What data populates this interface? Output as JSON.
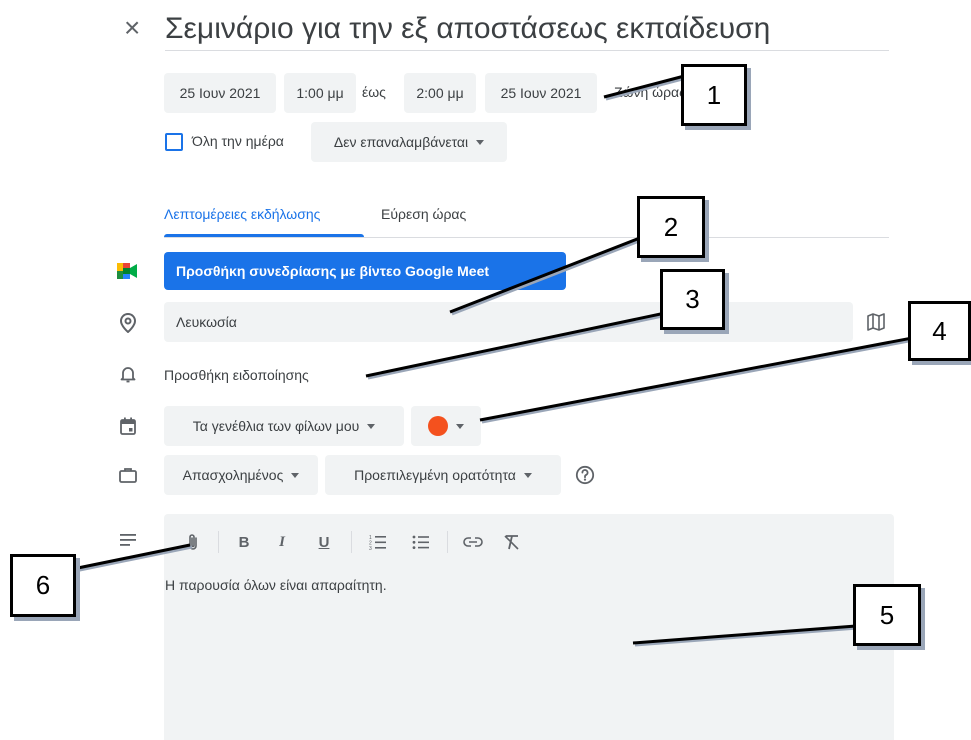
{
  "header": {
    "close_glyph": "×",
    "title": "Σεμινάριο για την εξ αποστάσεως εκπαίδευση"
  },
  "datetime": {
    "start_date": "25 Ιουν 2021",
    "start_time": "1:00 μμ",
    "until": "έως",
    "end_time": "2:00 μμ",
    "end_date": "25 Ιουν 2021",
    "timezone": "Ζώνη ώρας"
  },
  "allday": {
    "label": "Όλη την ημέρα",
    "checked": false,
    "repeat": "Δεν επαναλαμβάνεται"
  },
  "tabs": [
    {
      "label": "Λεπτομέρειες εκδήλωσης",
      "active": true
    },
    {
      "label": "Εύρεση ώρας",
      "active": false
    }
  ],
  "meet_button": "Προσθήκη συνεδρίασης με βίντεο Google Meet",
  "location": {
    "value": "Λευκωσία"
  },
  "notification": {
    "label": "Προσθήκη ειδοποίησης"
  },
  "calendar": {
    "name": "Τα γενέθλια των φίλων μου",
    "color": "#f4511e"
  },
  "availability": {
    "status": "Απασχολημένος",
    "visibility": "Προεπιλεγμένη ορατότητα"
  },
  "toolbar": {
    "bold": "B",
    "italic": "I",
    "underline": "U"
  },
  "description": {
    "text": "Η παρουσία όλων είναι απαραίτητη."
  },
  "callouts": [
    "1",
    "2",
    "3",
    "4",
    "5",
    "6"
  ],
  "colors": {
    "primary": "#1a73e8",
    "field_bg": "#f1f3f4",
    "text": "#3c4043",
    "icon": "#5f6368"
  }
}
